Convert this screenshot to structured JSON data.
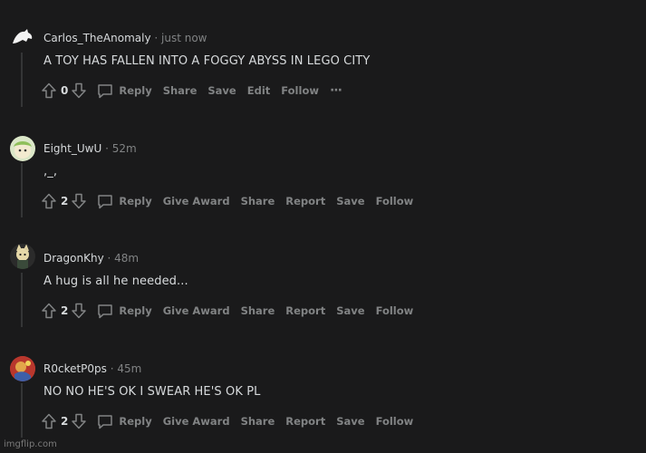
{
  "comments": [
    {
      "author": "Carlos_TheAnomaly",
      "time": "just now",
      "body": "A TOY HAS FALLEN INTO A FOGGY ABYSS IN LEGO CITY",
      "votes": "0",
      "actions": [
        "Reply",
        "Share",
        "Save",
        "Edit",
        "Follow"
      ],
      "more": "···"
    },
    {
      "author": "Eight_UwU",
      "time": "52m",
      "body": ",_,",
      "votes": "2",
      "actions": [
        "Reply",
        "Give Award",
        "Share",
        "Report",
        "Save",
        "Follow"
      ]
    },
    {
      "author": "DragonKhy",
      "time": "48m",
      "body": "A hug is all he needed...",
      "votes": "2",
      "actions": [
        "Reply",
        "Give Award",
        "Share",
        "Report",
        "Save",
        "Follow"
      ]
    },
    {
      "author": "R0cketP0ps",
      "time": "45m",
      "body": "NO NO HE'S OK I SWEAR HE'S OK PL",
      "votes": "2",
      "actions": [
        "Reply",
        "Give Award",
        "Share",
        "Report",
        "Save",
        "Follow"
      ]
    }
  ],
  "separator": "·",
  "watermark": "imgflip.com",
  "colors": {
    "background": "#1a1a1b",
    "text": "#d7dadc",
    "muted": "#818384",
    "thread_line": "#343536"
  }
}
